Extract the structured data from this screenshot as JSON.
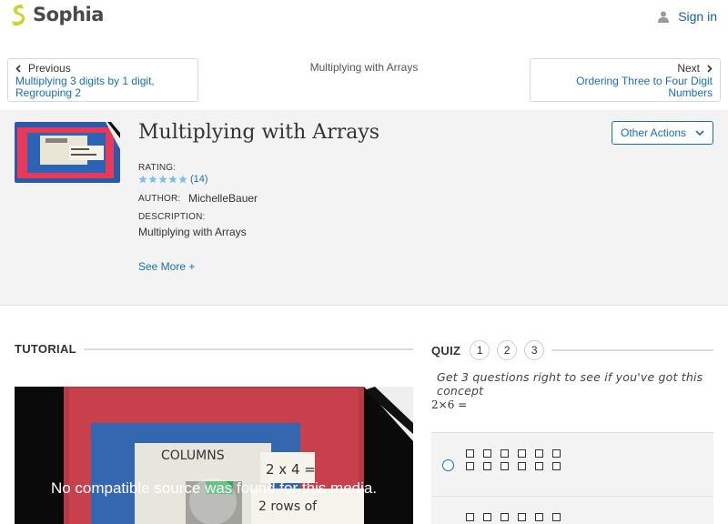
{
  "header": {
    "brand": "Sophia",
    "signin_label": "Sign in",
    "brand_color": "#c6d62b",
    "link_color": "#1a6fb0"
  },
  "nav": {
    "prev": {
      "label": "Previous",
      "title": "Multiplying 3 digits by 1 digit, Regrouping 2"
    },
    "current": "Multiplying with Arrays",
    "next": {
      "label": "Next",
      "title": "Ordering Three to Four Digit Numbers"
    }
  },
  "lesson": {
    "title": "Multiplying with Arrays",
    "other_actions_label": "Other Actions",
    "rating_label": "RATING:",
    "rating_count": "(14)",
    "stars": 5,
    "author_label": "AUTHOR:",
    "author": "MichelleBauer",
    "description_label": "DESCRIPTION:",
    "description": "Multiplying with Arrays",
    "see_more": "See More +"
  },
  "tutorial": {
    "heading": "TUTORIAL",
    "video_message": "No compatible source was found for this media."
  },
  "quiz": {
    "heading": "QUIZ",
    "steps": [
      "1",
      "2",
      "3"
    ],
    "prompt": "Get 3 questions right to see if you've got this concept",
    "question": "2×6 ="
  }
}
